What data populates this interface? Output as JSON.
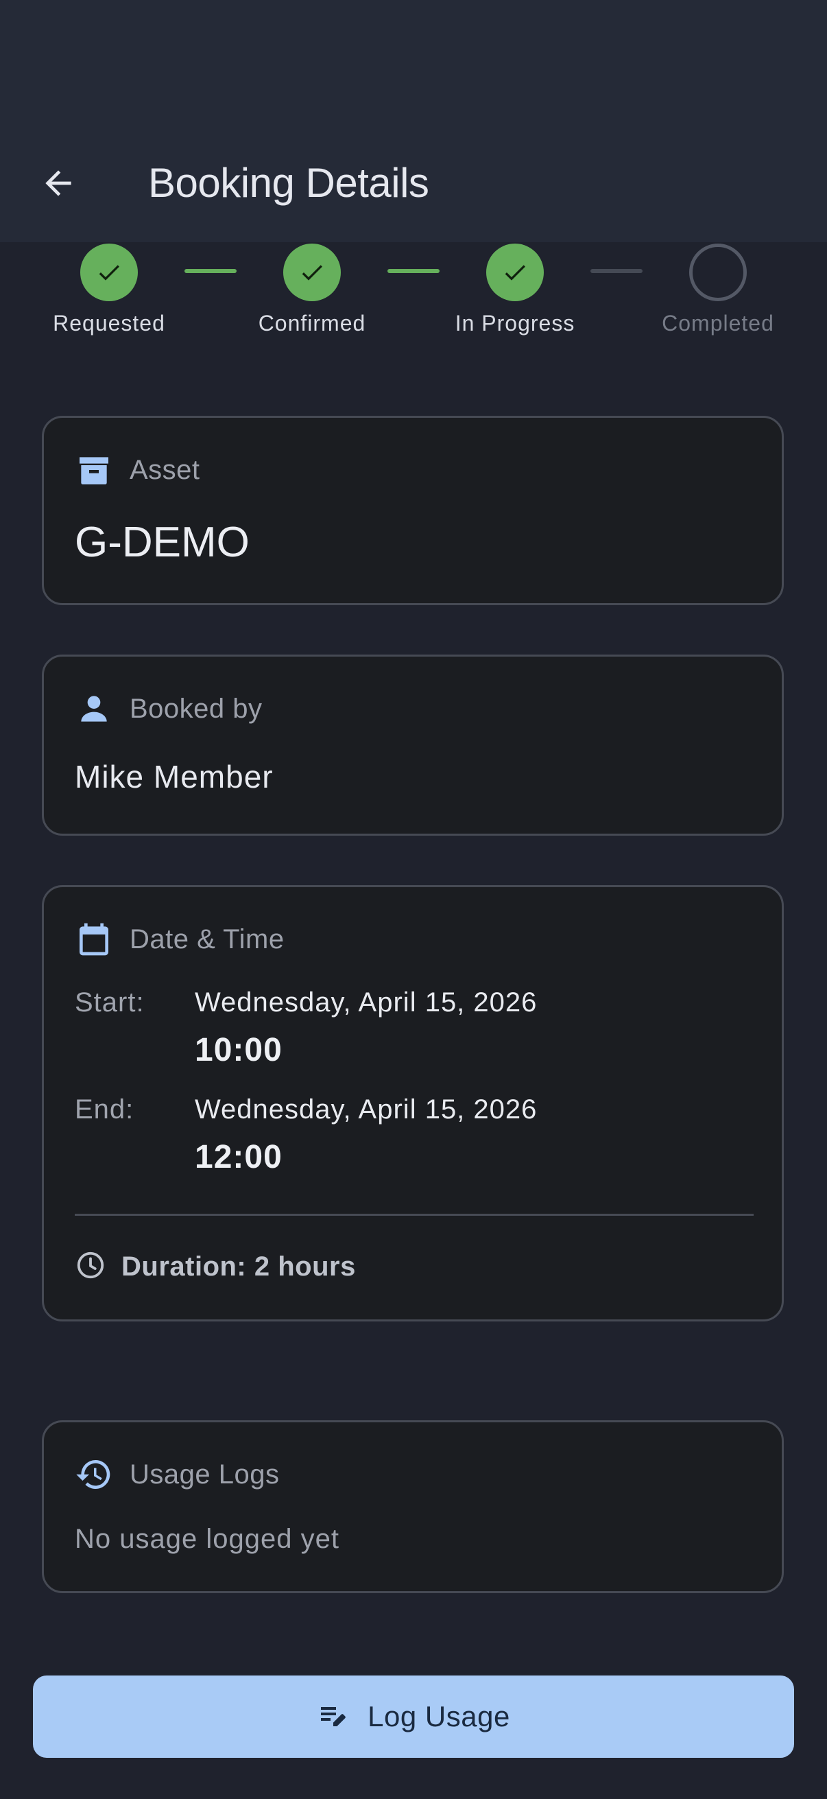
{
  "header": {
    "title": "Booking Details",
    "back_icon": "arrow-back-icon"
  },
  "stepper": {
    "steps": [
      {
        "label": "Requested",
        "status": "done"
      },
      {
        "label": "Confirmed",
        "status": "done"
      },
      {
        "label": "In Progress",
        "status": "done"
      },
      {
        "label": "Completed",
        "status": "pending"
      }
    ],
    "done_color": "#66b05c",
    "pending_color": "#545966"
  },
  "asset_card": {
    "label": "Asset",
    "value": "G-DEMO",
    "icon": "archive-box-icon"
  },
  "booked_by_card": {
    "label": "Booked by",
    "value": "Mike Member",
    "icon": "person-icon"
  },
  "datetime_card": {
    "label": "Date & Time",
    "icon": "calendar-icon",
    "start_key": "Start:",
    "start_date": "Wednesday, April 15, 2026",
    "start_time": "10:00",
    "end_key": "End:",
    "end_date": "Wednesday, April 15, 2026",
    "end_time": "12:00",
    "duration": "Duration: 2 hours",
    "duration_icon": "clock-icon"
  },
  "usage_card": {
    "label": "Usage Logs",
    "icon": "history-icon",
    "empty_text": "No usage logged yet"
  },
  "action": {
    "label": "Log Usage",
    "icon": "edit-note-icon",
    "color": "#a9cbf6"
  },
  "accent_icon_color": "#a6c8f7"
}
